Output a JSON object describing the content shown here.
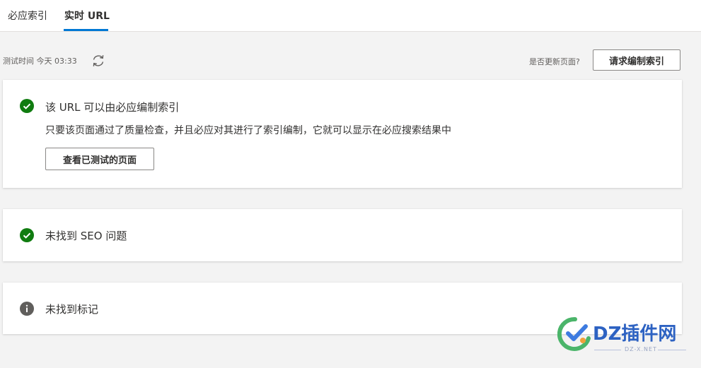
{
  "tabs": [
    {
      "label": "必应索引",
      "active": false
    },
    {
      "label": "实时 URL",
      "active": true
    }
  ],
  "test_bar": {
    "test_time": "测试时间 今天 03:33",
    "update_question": "是否更新页面?",
    "request_index_label": "请求编制索引"
  },
  "cards": [
    {
      "status": "success",
      "title": "该 URL 可以由必应编制索引",
      "description": "只要该页面通过了质量检查，并且必应对其进行了索引编制，它就可以显示在必应搜索结果中",
      "button_label": "查看已测试的页面"
    },
    {
      "status": "success",
      "title": "未找到 SEO 问题"
    },
    {
      "status": "info",
      "title": "未找到标记"
    }
  ],
  "watermark": {
    "brand": "DZ插件网",
    "domain": "DZ-X.NET"
  },
  "colors": {
    "accent": "#0078d4",
    "success": "#107c10",
    "info": "#605e5c"
  }
}
